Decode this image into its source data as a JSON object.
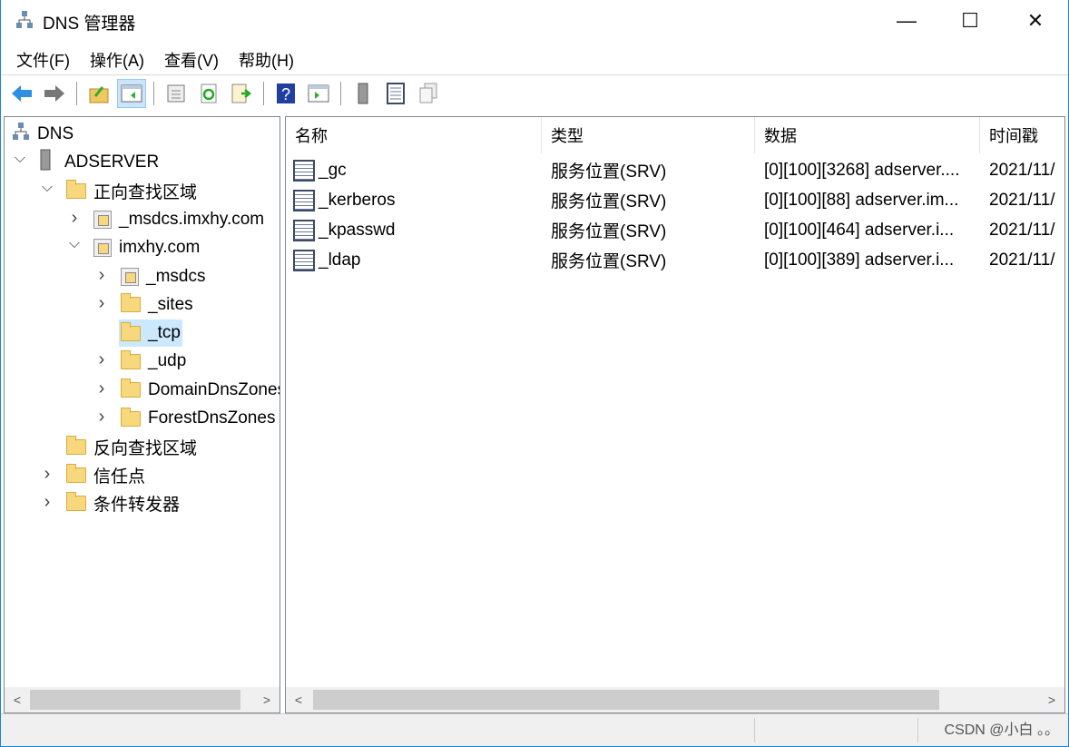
{
  "window": {
    "title": "DNS 管理器",
    "min": "—",
    "max": "☐",
    "close": "✕"
  },
  "menu": [
    "文件(F)",
    "操作(A)",
    "查看(V)",
    "帮助(H)"
  ],
  "toolbar": [
    "back",
    "forward",
    "up",
    "show-hide-tree",
    "properties",
    "refresh",
    "export",
    "help",
    "show-hide-action",
    "server",
    "record-list",
    "copy"
  ],
  "tree": [
    {
      "label": "DNS",
      "level": 0,
      "chev": "",
      "icon": "dns"
    },
    {
      "label": "ADSERVER",
      "level": 0,
      "chev": "v",
      "icon": "server",
      "indent": 1
    },
    {
      "label": "正向查找区域",
      "level": 2,
      "chev": "v",
      "icon": "folder"
    },
    {
      "label": "_msdcs.imxhy.com",
      "level": 3,
      "chev": ">",
      "icon": "zone"
    },
    {
      "label": "imxhy.com",
      "level": 3,
      "chev": "v",
      "icon": "zone"
    },
    {
      "label": "_msdcs",
      "level": 4,
      "chev": ">",
      "icon": "zone-gray"
    },
    {
      "label": "_sites",
      "level": 4,
      "chev": ">",
      "icon": "folder"
    },
    {
      "label": "_tcp",
      "level": 4,
      "chev": "",
      "icon": "folder",
      "selected": true
    },
    {
      "label": "_udp",
      "level": 4,
      "chev": ">",
      "icon": "folder"
    },
    {
      "label": "DomainDnsZones",
      "level": 4,
      "chev": ">",
      "icon": "folder"
    },
    {
      "label": "ForestDnsZones",
      "level": 4,
      "chev": ">",
      "icon": "folder"
    },
    {
      "label": "反向查找区域",
      "level": 2,
      "chev": "",
      "icon": "folder"
    },
    {
      "label": "信任点",
      "level": 2,
      "chev": ">",
      "icon": "folder"
    },
    {
      "label": "条件转发器",
      "level": 2,
      "chev": ">",
      "icon": "folder"
    }
  ],
  "columns": [
    "名称",
    "类型",
    "数据",
    "时间戳"
  ],
  "records": [
    {
      "name": "_gc",
      "type": "服务位置(SRV)",
      "data": "[0][100][3268] adserver....",
      "time": "2021/11/"
    },
    {
      "name": "_kerberos",
      "type": "服务位置(SRV)",
      "data": "[0][100][88] adserver.im...",
      "time": "2021/11/"
    },
    {
      "name": "_kpasswd",
      "type": "服务位置(SRV)",
      "data": "[0][100][464] adserver.i...",
      "time": "2021/11/"
    },
    {
      "name": "_ldap",
      "type": "服务位置(SRV)",
      "data": "[0][100][389] adserver.i...",
      "time": "2021/11/"
    }
  ],
  "watermark": "CSDN @小白 。。"
}
